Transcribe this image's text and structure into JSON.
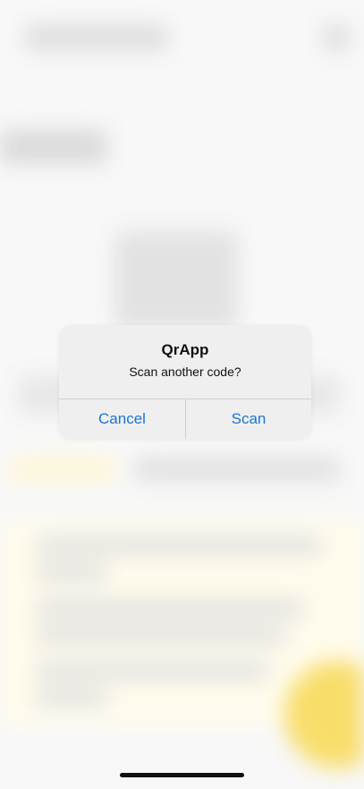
{
  "alert": {
    "title": "QrApp",
    "message": "Scan another code?",
    "buttons": {
      "cancel": "Cancel",
      "scan": "Scan"
    }
  },
  "colors": {
    "accent": "#1a76d2",
    "alert_background": "#eeeeee",
    "highlight_yellow": "#f7d64a"
  }
}
